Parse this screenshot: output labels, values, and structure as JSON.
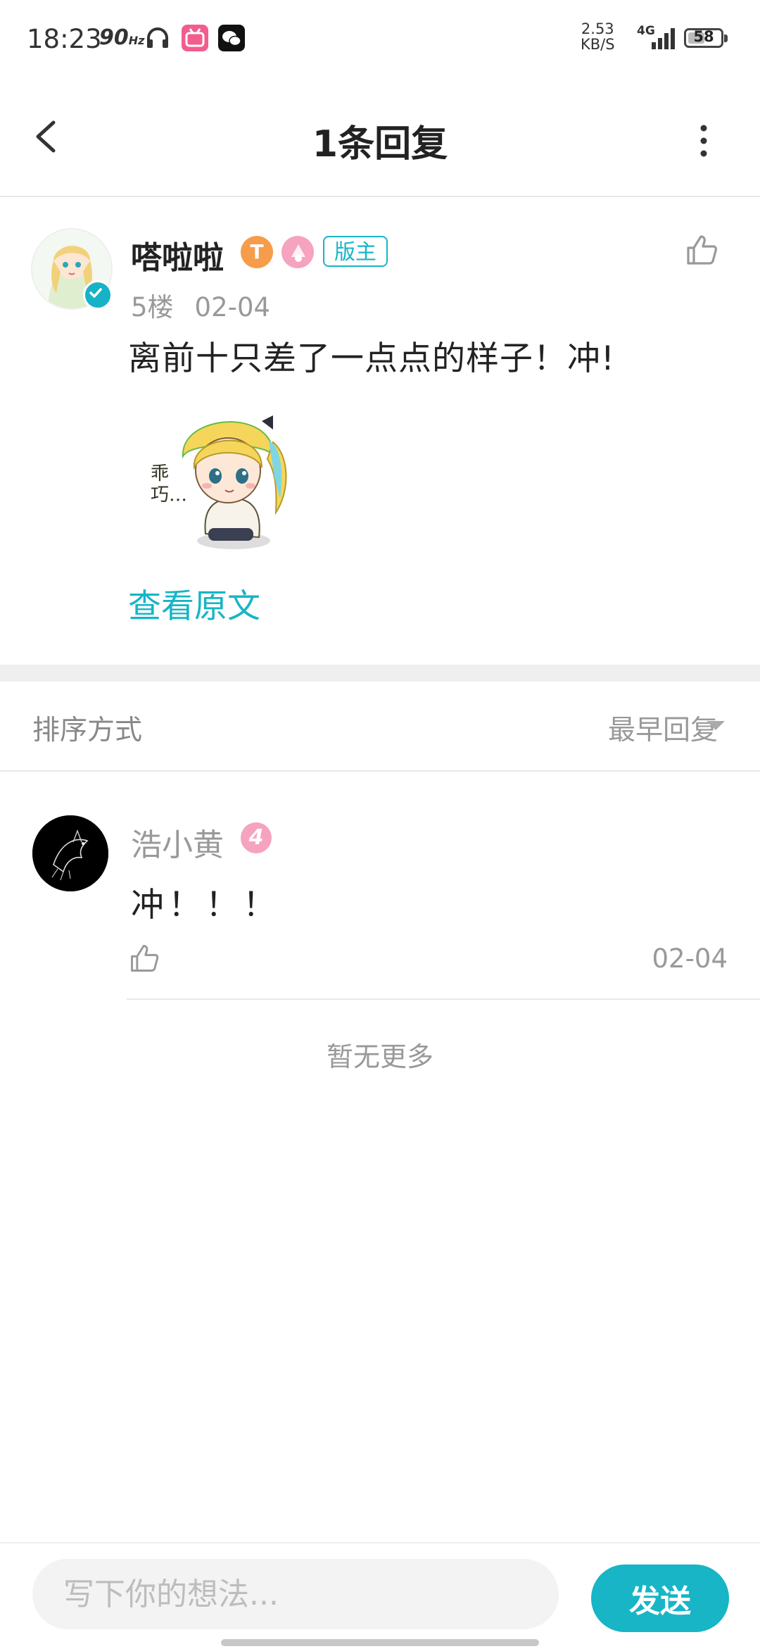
{
  "status_bar": {
    "time": "18:23",
    "refresh_rate": "90",
    "refresh_unit": "Hz",
    "net_speed_value": "2.53",
    "net_speed_unit": "KB/S",
    "network": "4G",
    "battery": "58",
    "battery_level_percent": 58
  },
  "header": {
    "title": "1条回复"
  },
  "post": {
    "author": "嗒啦啦",
    "level_badge": "T",
    "role_tag": "版主",
    "floor": "5楼",
    "date": "02-04",
    "content": "离前十只差了一点点的样子！冲!",
    "sticker_caption": "乖巧…",
    "view_original": "查看原文"
  },
  "sort": {
    "label": "排序方式",
    "value": "最早回复"
  },
  "reply": {
    "author": "浩小黄",
    "level": "4",
    "content": "冲！！！",
    "date": "02-04"
  },
  "no_more": "暂无更多",
  "composer": {
    "placeholder": "写下你的想法...",
    "send_label": "发送"
  },
  "colors": {
    "accent": "#17b5c6",
    "badge_pink": "#f5a3be",
    "badge_orange": "#f79c4a"
  }
}
